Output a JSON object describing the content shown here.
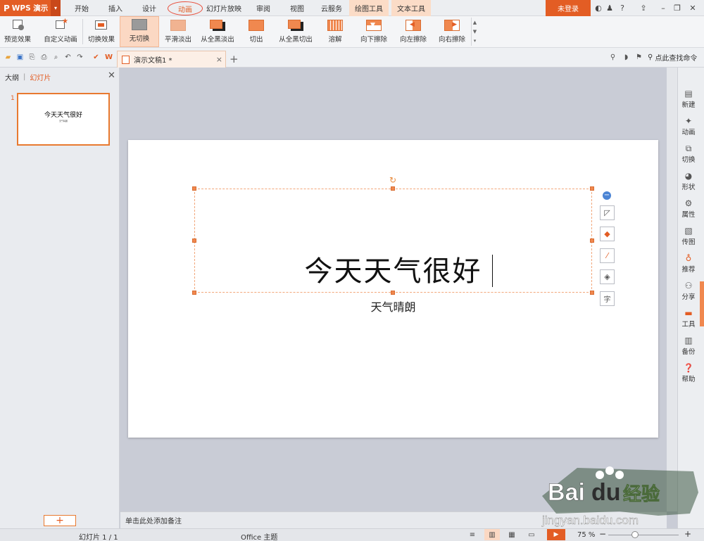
{
  "app": {
    "name": "WPS 演示"
  },
  "tabs": [
    {
      "label": "开始"
    },
    {
      "label": "插入"
    },
    {
      "label": "设计"
    },
    {
      "label": "动画"
    },
    {
      "label": "幻灯片放映"
    },
    {
      "label": "审阅"
    },
    {
      "label": "视图"
    },
    {
      "label": "云服务"
    },
    {
      "label": "绘图工具"
    },
    {
      "label": "文本工具"
    }
  ],
  "login": {
    "label": "未登录"
  },
  "ribbon": {
    "preview": "预览效果",
    "custom_anim": "自定义动画",
    "switch_effect": "切换效果",
    "transitions": [
      "无切换",
      "平滑淡出",
      "从全黑淡出",
      "切出",
      "从全黑切出",
      "溶解",
      "向下擦除",
      "向左擦除",
      "向右擦除"
    ]
  },
  "doc_tab": {
    "title": "演示文稿1 *"
  },
  "search_cmd": "点此查找命令",
  "left_panel": {
    "outline_tab": "大纲",
    "slides_tab": "幻灯片",
    "slide_number": "1"
  },
  "slide": {
    "title": "今天天气很好",
    "subtitle": "天气晴朗"
  },
  "notes": {
    "placeholder": "单击此处添加备注"
  },
  "right_sidebar": [
    "新建",
    "动画",
    "切换",
    "形状",
    "属性",
    "传图",
    "推荐",
    "分享",
    "工具",
    "备份",
    "帮助"
  ],
  "status": {
    "slide_count": "幻灯片 1 / 1",
    "theme": "Office 主题",
    "zoom": "75 %"
  },
  "watermark": {
    "brand": "Baidu经验",
    "url": "jingyan.baidu.com"
  },
  "colors": {
    "accent": "#e35d24",
    "ribbon_active": "#fbd8c3",
    "workspace": "#c9ccd6"
  }
}
